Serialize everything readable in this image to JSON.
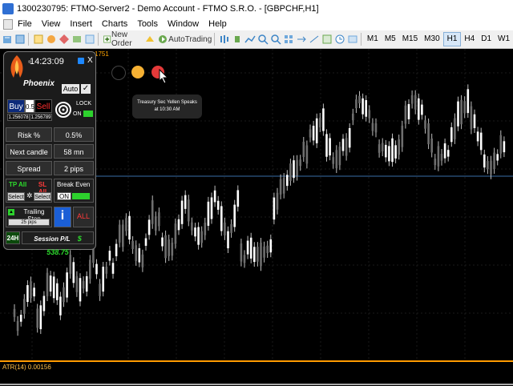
{
  "window": {
    "title": "1300230795: FTMO-Server2 - Demo Account - FTMO S.R.O. - [GBPCHF,H1]"
  },
  "menu": [
    "File",
    "View",
    "Insert",
    "Charts",
    "Tools",
    "Window",
    "Help"
  ],
  "toolbar": {
    "new_order_label": "New Order",
    "autotrading_label": "AutoTrading",
    "timeframes": [
      "M1",
      "M5",
      "M15",
      "M30",
      "H1",
      "H4",
      "D1",
      "W1"
    ],
    "active_timeframe": "H1"
  },
  "chart": {
    "price_label": "1751",
    "series_color": "#ffffff",
    "horizontal_line_color": "#3a6ea8"
  },
  "indicator": {
    "label": "ATR(14) 0.00156"
  },
  "panel": {
    "time": "14:23:09",
    "brand": "Phoenix",
    "auto_label": "Auto",
    "check_mark": "✓",
    "buy_label": "Buy",
    "lot": "0.5",
    "sell_label": "Sell",
    "buy_price": "1.256078",
    "sell_price": "1.256789",
    "lock_label": "LOCK",
    "lock_on": "ON",
    "risk_label": "Risk %",
    "risk_value": "0.5%",
    "next_candle_label": "Next candle",
    "next_candle_value": "58 mn",
    "spread_label": "Spread",
    "spread_value": "2 pips",
    "tp_label": "TP All",
    "sl_label": "SL All",
    "select_left": "Select",
    "select_right": "Select",
    "break_even_label": "Break Even",
    "break_even_on": "ON",
    "trailing_label": "Trailing Stop",
    "trailing_value": "25 pips",
    "info_label": "i",
    "xall_label": "ALL",
    "h24_label": "24H",
    "session_label": "Session P/L",
    "session_value": "$ 538.75"
  },
  "news": {
    "line1": "Treasury Sec Yellen Speaks",
    "line2": "at 10:30 AM"
  },
  "colors": {
    "orange": "#ffa500",
    "green": "#2ddc2d",
    "red": "#ff3b3b",
    "blue": "#1b5fd6"
  }
}
